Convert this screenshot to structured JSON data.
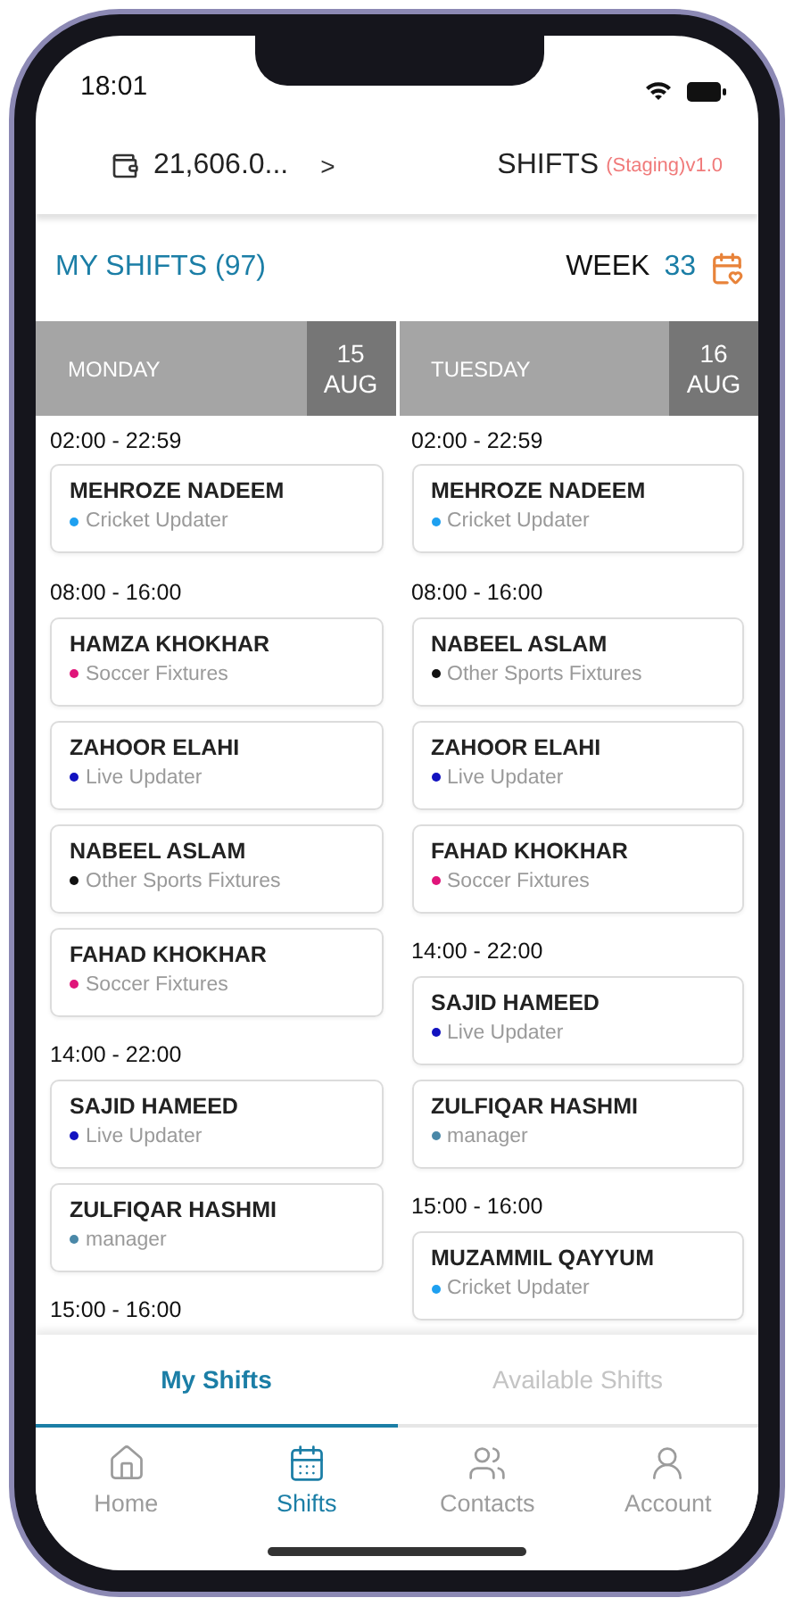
{
  "status_bar": {
    "time": "18:01"
  },
  "header": {
    "balance": "21,606.0...",
    "chevron": ">",
    "title": "SHIFTS",
    "environment": "(Staging)v1.0"
  },
  "section": {
    "title": "MY SHIFTS (97)",
    "week_label": "WEEK",
    "week_number": "33"
  },
  "days": [
    {
      "name": "MONDAY",
      "date_day": "15",
      "date_month": "AUG",
      "slots": [
        {
          "time": "02:00 - 22:59",
          "shifts": [
            {
              "name": "MEHROZE NADEEM",
              "role": "Cricket Updater",
              "color": "#1ea0f0"
            }
          ]
        },
        {
          "time": "08:00 - 16:00",
          "shifts": [
            {
              "name": "HAMZA KHOKHAR",
              "role": "Soccer Fixtures",
              "color": "#e0157a"
            },
            {
              "name": "ZAHOOR ELAHI",
              "role": "Live Updater",
              "color": "#1212c0"
            },
            {
              "name": "NABEEL ASLAM",
              "role": "Other Sports Fixtures",
              "color": "#111111"
            },
            {
              "name": "FAHAD KHOKHAR",
              "role": "Soccer Fixtures",
              "color": "#e0157a"
            }
          ]
        },
        {
          "time": "14:00 - 22:00",
          "shifts": [
            {
              "name": "SAJID HAMEED",
              "role": "Live Updater",
              "color": "#1212c0"
            },
            {
              "name": "ZULFIQAR HASHMI",
              "role": "manager",
              "color": "#4a88a8"
            }
          ]
        },
        {
          "time": "15:00 - 16:00"
        }
      ]
    },
    {
      "name": "TUESDAY",
      "date_day": "16",
      "date_month": "AUG",
      "slots": [
        {
          "time": "02:00 - 22:59",
          "shifts": [
            {
              "name": "MEHROZE NADEEM",
              "role": "Cricket Updater",
              "color": "#1ea0f0"
            }
          ]
        },
        {
          "time": "08:00 - 16:00",
          "shifts": [
            {
              "name": "NABEEL ASLAM",
              "role": "Other Sports Fixtures",
              "color": "#111111"
            },
            {
              "name": "ZAHOOR ELAHI",
              "role": "Live Updater",
              "color": "#1212c0"
            },
            {
              "name": "FAHAD KHOKHAR",
              "role": "Soccer Fixtures",
              "color": "#e0157a"
            }
          ]
        },
        {
          "time": "14:00 - 22:00",
          "shifts": [
            {
              "name": "SAJID HAMEED",
              "role": "Live Updater",
              "color": "#1212c0"
            },
            {
              "name": "ZULFIQAR HASHMI",
              "role": "manager",
              "color": "#4a88a8"
            }
          ]
        },
        {
          "time": "15:00 - 16:00",
          "shifts": [
            {
              "name": "MUZAMMIL QAYYUM",
              "role": "Cricket Updater",
              "color": "#1ea0f0"
            }
          ]
        }
      ]
    }
  ],
  "tabs": [
    {
      "label": "My Shifts",
      "selected": true
    },
    {
      "label": "Available Shifts",
      "selected": false
    }
  ],
  "nav": {
    "items": [
      {
        "kind": "home",
        "label": "Home",
        "selected": false
      },
      {
        "kind": "shifts",
        "label": "Shifts",
        "selected": true
      },
      {
        "kind": "contacts",
        "label": "Contacts",
        "selected": false
      },
      {
        "kind": "account",
        "label": "Account",
        "selected": false
      }
    ]
  }
}
